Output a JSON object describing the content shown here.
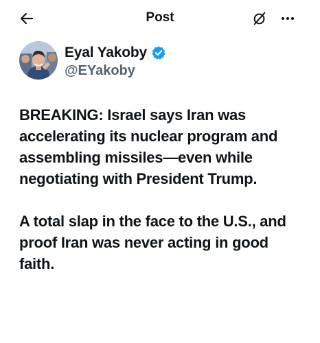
{
  "header": {
    "title": "Post",
    "back_icon": "arrow-left-icon",
    "grok_icon": "grok-icon",
    "more_icon": "more-horizontal-icon"
  },
  "author": {
    "name": "Eyal Yakoby",
    "handle": "@EYakoby",
    "verified": true,
    "verified_color": "#1d9bf0"
  },
  "post": {
    "paragraphs": [
      "BREAKING: Israel says Iran was accelerating its nuclear program and assembling missiles—even while negotiating with President Trump.",
      "A total slap in the face to the U.S., and proof Iran was never acting in good faith."
    ]
  },
  "colors": {
    "text": "#0f1419",
    "secondary": "#536471",
    "background": "#ffffff"
  }
}
